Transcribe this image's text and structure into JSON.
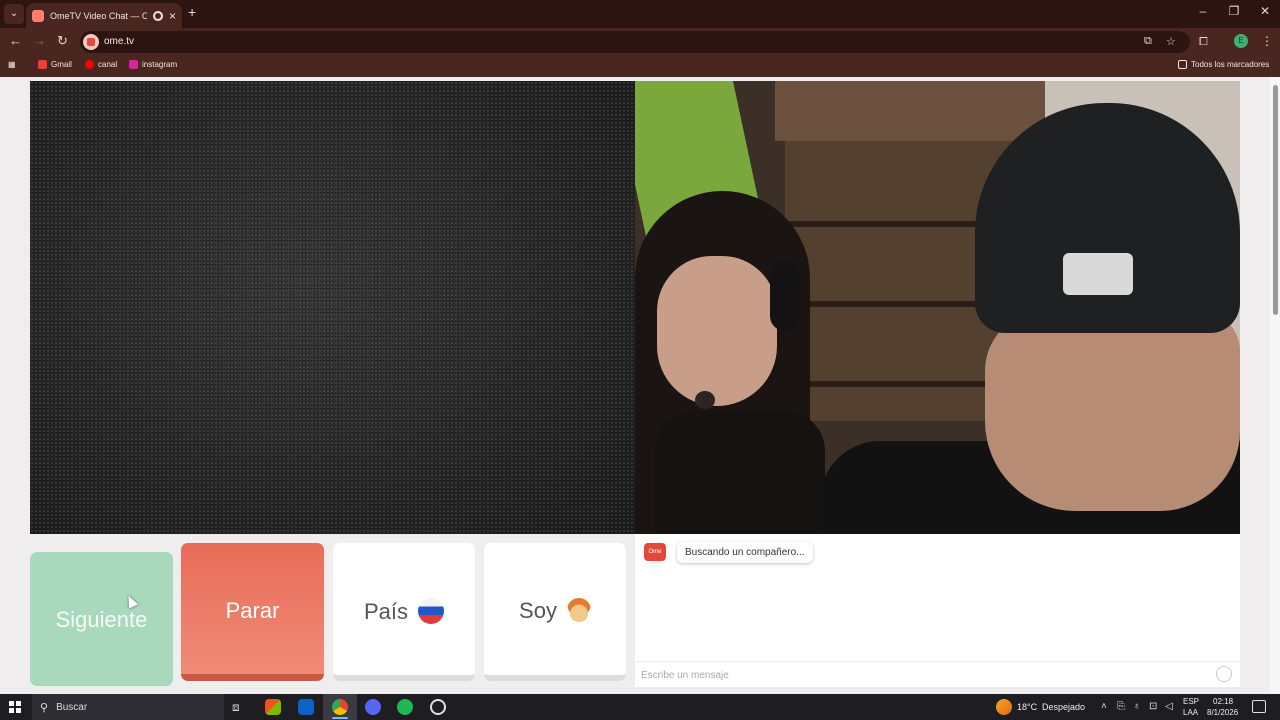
{
  "browser": {
    "tab_title": "OmeTV Video Chat — Ome",
    "url": "ome.tv",
    "bookmarks": [
      {
        "label": "Gmail",
        "color": "#ea4335"
      },
      {
        "label": "canal",
        "color": "#ff0000"
      },
      {
        "label": "instagram",
        "color": "#d6249f"
      }
    ],
    "all_bookmarks_label": "Todos los marcadores",
    "profile_initial": "E"
  },
  "controls": {
    "next_label": "Siguiente",
    "stop_label": "Parar",
    "country_label": "País",
    "gender_label": "Soy"
  },
  "chat": {
    "logo_text": "Ome TV",
    "status_message": "Buscando un compañero...",
    "input_placeholder": "Escribe un mensaje"
  },
  "taskbar": {
    "search_label": "Buscar",
    "weather_temp": "18°C",
    "weather_desc": "Despejado",
    "language_line1": "ESP",
    "language_line2": "LAA",
    "time": "02:18",
    "date": "8/1/2026"
  },
  "colors": {
    "next_button": "#a8d9bd",
    "stop_button": "#e86c58",
    "brand": "#e2493b"
  }
}
